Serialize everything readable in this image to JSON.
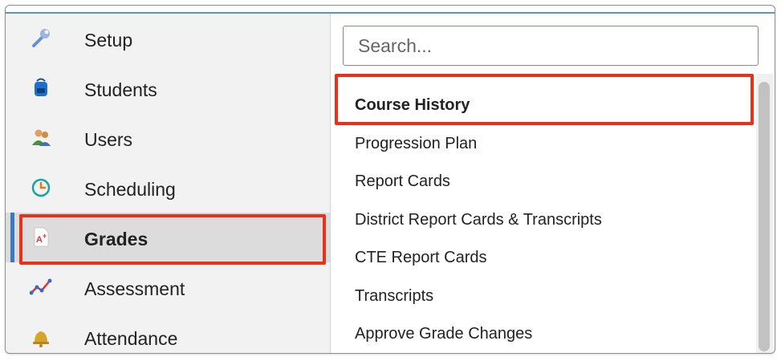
{
  "nav": {
    "items": [
      {
        "label": "Setup",
        "icon": "wrench-icon"
      },
      {
        "label": "Students",
        "icon": "backpack-icon"
      },
      {
        "label": "Users",
        "icon": "users-icon"
      },
      {
        "label": "Scheduling",
        "icon": "clock-icon"
      },
      {
        "label": "Grades",
        "icon": "grade-paper-icon",
        "active": true
      },
      {
        "label": "Assessment",
        "icon": "trend-chart-icon"
      },
      {
        "label": "Attendance",
        "icon": "bell-icon"
      }
    ]
  },
  "search": {
    "placeholder": "Search..."
  },
  "submenu": {
    "items": [
      "Course History",
      "Progression Plan",
      "Report Cards",
      "District Report Cards & Transcripts",
      "CTE Report Cards",
      "Transcripts",
      "Approve Grade Changes"
    ]
  },
  "colors": {
    "highlight": "#e8301a",
    "accent": "#3b79c7",
    "top_border": "#5b8fd6"
  }
}
